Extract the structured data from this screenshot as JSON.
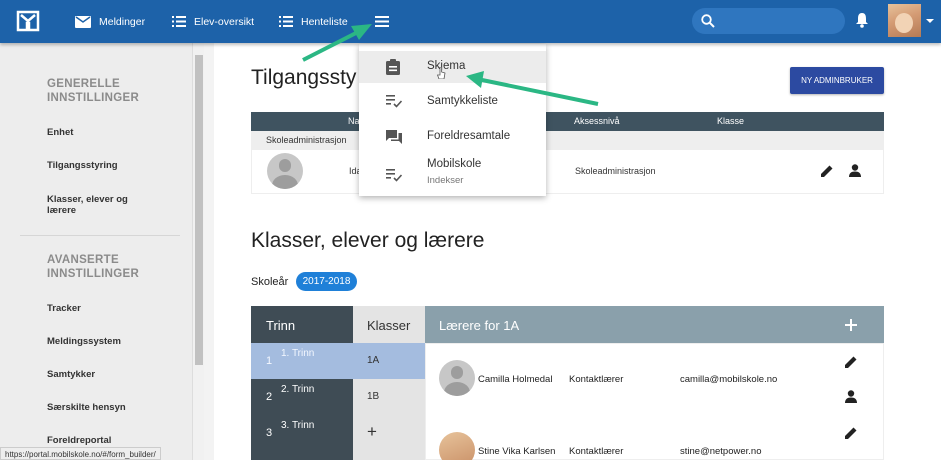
{
  "nav": {
    "items": [
      {
        "label": "Meldinger",
        "icon": "mail-icon"
      },
      {
        "label": "Elev-oversikt",
        "icon": "list-icon"
      },
      {
        "label": "Henteliste",
        "icon": "list-icon"
      }
    ],
    "menu_icon": "hamburger-menu-icon",
    "search_placeholder": ""
  },
  "dropdown": {
    "items": [
      {
        "label": "Skjema",
        "icon": "clipboard-icon"
      },
      {
        "label": "Samtykkeliste",
        "icon": "checklist-icon"
      },
      {
        "label": "Foreldresamtale",
        "icon": "chat-icon"
      },
      {
        "label": "Mobilskole",
        "sub": "Indekser",
        "icon": "checklist-icon"
      }
    ]
  },
  "sidebar": {
    "section1": "GENERELLE INNSTILLINGER",
    "items1": [
      "Enhet",
      "Tilgangsstyring",
      "Klasser, elever og lærere"
    ],
    "section2": "AVANSERTE INNSTILLINGER",
    "items2": [
      "Tracker",
      "Meldingssystem",
      "Samtykker",
      "Særskilte hensyn",
      "Foreldreportal"
    ]
  },
  "status_url": "https://portal.mobilskole.no/#/form_builder/",
  "access": {
    "title": "Tilgangssty",
    "new_admin_button": "NY ADMINBRUKER",
    "columns": [
      "Na",
      "Aksessnivå",
      "Klasse"
    ],
    "group": "Skoleadministrasjon",
    "rows": [
      {
        "name": "Ida",
        "level": "Skoleadministrasjon"
      }
    ]
  },
  "classes": {
    "title": "Klasser, elever og lærere",
    "year_label": "Skoleår",
    "year": "2017-2018",
    "trinn_header": "Trinn",
    "klasser_header": "Klasser",
    "trinn": [
      {
        "num": "1",
        "label": "1. Trinn",
        "selected": true
      },
      {
        "num": "2",
        "label": "2. Trinn",
        "selected": false
      },
      {
        "num": "3",
        "label": "3. Trinn",
        "selected": false
      }
    ],
    "klasser": [
      "1A",
      "1B",
      "+"
    ],
    "teachers_header": "Lærere for 1A",
    "teachers": [
      {
        "name": "Camilla Holmedal",
        "role": "Kontaktlærer",
        "email": "camilla@mobilskole.no"
      },
      {
        "name": "Stine Vika Karlsen",
        "role": "Kontaktlærer",
        "email": "stine@netpower.no"
      }
    ]
  },
  "colors": {
    "topbar": "#1d62a9",
    "accent": "#2c4aa1",
    "badge": "#1f80d8",
    "arrow": "#2bb784"
  }
}
